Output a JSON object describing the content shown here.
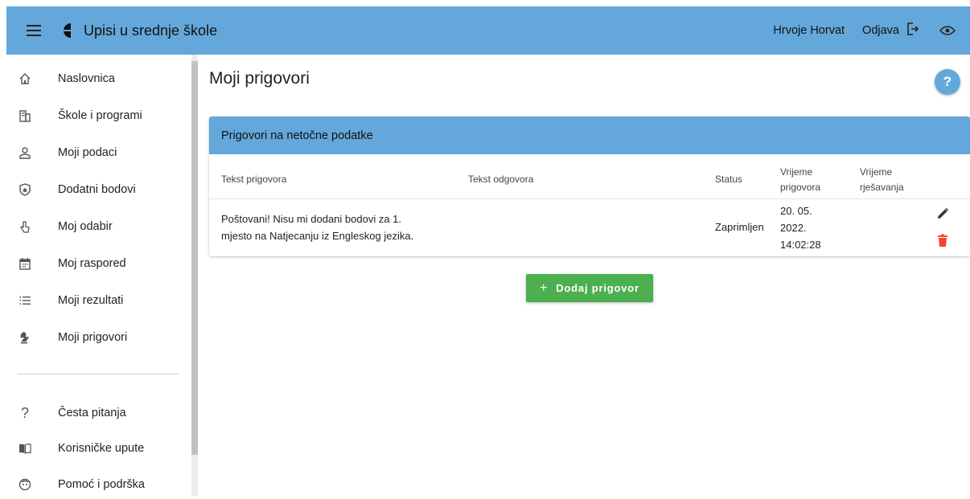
{
  "header": {
    "app_title": "Upisi u srednje škole",
    "user_name": "Hrvoje Horvat",
    "logout_label": "Odjava",
    "bar_color": "#64a8db"
  },
  "sidebar": {
    "items": [
      {
        "label": "Naslovnica",
        "icon": "home-icon"
      },
      {
        "label": "Škole i programi",
        "icon": "building-icon"
      },
      {
        "label": "Moji podaci",
        "icon": "person-icon"
      },
      {
        "label": "Dodatni bodovi",
        "icon": "star-shield-icon"
      },
      {
        "label": "Moj odabir",
        "icon": "pointer-hand-icon"
      },
      {
        "label": "Moj raspored",
        "icon": "calendar-icon"
      },
      {
        "label": "Moji rezultati",
        "icon": "numbered-list-icon"
      },
      {
        "label": "Moji prigovori",
        "icon": "raised-hand-icon"
      },
      {
        "label": "Česta pitanja",
        "icon": "question-icon"
      },
      {
        "label": "Korisničke upute",
        "icon": "book-icon"
      },
      {
        "label": "Pomoć i podrška",
        "icon": "support-icon"
      }
    ]
  },
  "main": {
    "page_title": "Moji prigovori",
    "help_label": "?",
    "card": {
      "title": "Prigovori na netočne podatke",
      "columns": {
        "complaint_text": "Tekst prigovora",
        "response_text": "Tekst odgovora",
        "status": "Status",
        "complaint_time_line1": "Vrijeme",
        "complaint_time_line2": "prigovora",
        "resolution_time_line1": "Vrijeme",
        "resolution_time_line2": "rješavanja"
      },
      "rows": [
        {
          "complaint_line1": "Poštovani! Nisu mi dodani bodovi za 1.",
          "complaint_line2": "mjesto na Natjecanju iz Engleskog jezika.",
          "response": "",
          "status": "Zaprimljen",
          "time_line1": "20. 05.",
          "time_line2": "2022.",
          "time_line3": "14:02:28",
          "resolution_time": ""
        }
      ]
    },
    "add_button_label": "Dodaj prigovor",
    "add_button_color": "#4caf50",
    "delete_color": "#f44336"
  }
}
